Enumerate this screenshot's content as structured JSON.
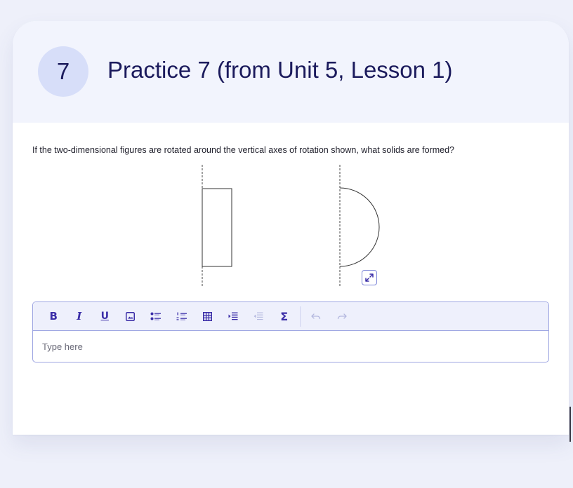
{
  "practice": {
    "number": "7",
    "title": "Practice 7 (from Unit 5, Lesson 1)"
  },
  "question": {
    "prompt": "If the two-dimensional figures are rotated around the vertical axes of rotation shown, what solids are formed?"
  },
  "figure": {
    "shapes": [
      "rectangle",
      "semicircle"
    ],
    "axis_style": "dashed-vertical",
    "expand_icon": "expand-arrows-icon"
  },
  "editor": {
    "placeholder": "Type here",
    "toolbar": [
      {
        "name": "bold-button",
        "glyph": "B"
      },
      {
        "name": "italic-button",
        "glyph": "I"
      },
      {
        "name": "underline-button",
        "glyph": "U"
      },
      {
        "name": "image-button",
        "icon": "image-icon"
      },
      {
        "name": "bullet-list-button",
        "icon": "bullet-list-icon"
      },
      {
        "name": "numbered-list-button",
        "icon": "numbered-list-icon"
      },
      {
        "name": "table-button",
        "icon": "table-icon"
      },
      {
        "name": "indent-button",
        "icon": "indent-icon"
      },
      {
        "name": "outdent-button",
        "icon": "outdent-icon",
        "disabled": true
      },
      {
        "name": "sigma-button",
        "glyph": "Σ"
      },
      {
        "name": "undo-button",
        "icon": "undo-icon",
        "disabled": true
      },
      {
        "name": "redo-button",
        "icon": "redo-icon",
        "disabled": true
      }
    ]
  },
  "colors": {
    "title": "#1b1a5c",
    "badge_bg": "#d7def9",
    "header_bg": "#f2f4fd",
    "accent": "#3b2ea8",
    "border": "#9ea6e2"
  }
}
